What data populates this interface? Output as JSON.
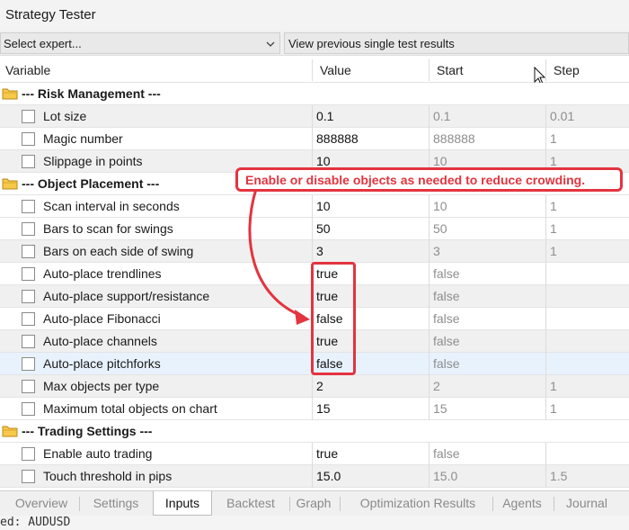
{
  "window": {
    "title": "Strategy Tester"
  },
  "toolbar": {
    "expert_select": "Select expert...",
    "view_previous": "View previous single test results"
  },
  "columns": {
    "variable": "Variable",
    "value": "Value",
    "start": "Start",
    "step": "Step"
  },
  "rows": [
    {
      "kind": "group",
      "label": "--- Risk Management ---"
    },
    {
      "kind": "param",
      "label": "Lot size",
      "value": "0.1",
      "start": "0.1",
      "step": "0.01",
      "shade": "gray"
    },
    {
      "kind": "param",
      "label": "Magic number",
      "value": "888888",
      "start": "888888",
      "step": "1",
      "shade": "white"
    },
    {
      "kind": "param",
      "label": "Slippage in points",
      "value": "10",
      "start": "10",
      "step": "1",
      "shade": "gray"
    },
    {
      "kind": "group",
      "label": "--- Object Placement ---"
    },
    {
      "kind": "param",
      "label": "Scan interval in seconds",
      "value": "10",
      "start": "10",
      "step": "1",
      "shade": "white"
    },
    {
      "kind": "param",
      "label": "Bars to scan for swings",
      "value": "50",
      "start": "50",
      "step": "1",
      "shade": "white"
    },
    {
      "kind": "param",
      "label": "Bars on each side of swing",
      "value": "3",
      "start": "3",
      "step": "1",
      "shade": "gray"
    },
    {
      "kind": "param",
      "label": "Auto-place trendlines",
      "value": "true",
      "start": "false",
      "step": "",
      "shade": "white"
    },
    {
      "kind": "param",
      "label": "Auto-place support/resistance",
      "value": "true",
      "start": "false",
      "step": "",
      "shade": "gray"
    },
    {
      "kind": "param",
      "label": "Auto-place Fibonacci",
      "value": "false",
      "start": "false",
      "step": "",
      "shade": "white"
    },
    {
      "kind": "param",
      "label": "Auto-place channels",
      "value": "true",
      "start": "false",
      "step": "",
      "shade": "gray"
    },
    {
      "kind": "param",
      "label": "Auto-place pitchforks",
      "value": "false",
      "start": "false",
      "step": "",
      "shade": "sel"
    },
    {
      "kind": "param",
      "label": "Max objects per type",
      "value": "2",
      "start": "2",
      "step": "1",
      "shade": "gray"
    },
    {
      "kind": "param",
      "label": "Maximum total objects on chart",
      "value": "15",
      "start": "15",
      "step": "1",
      "shade": "white"
    },
    {
      "kind": "group",
      "label": "--- Trading Settings ---"
    },
    {
      "kind": "param",
      "label": "Enable auto trading",
      "value": "true",
      "start": "false",
      "step": "",
      "shade": "white"
    },
    {
      "kind": "param",
      "label": "Touch threshold in pips",
      "value": "15.0",
      "start": "15.0",
      "step": "1.5",
      "shade": "gray"
    }
  ],
  "tabs": [
    {
      "label": "Overview",
      "active": false
    },
    {
      "label": "Settings",
      "active": false
    },
    {
      "label": "Inputs",
      "active": true
    },
    {
      "label": "Backtest",
      "active": false
    },
    {
      "label": "Graph",
      "active": false
    },
    {
      "label": "Optimization Results",
      "active": false
    },
    {
      "label": "Agents",
      "active": false
    },
    {
      "label": "Journal",
      "active": false
    }
  ],
  "console": {
    "text": "ed: AUDUSD"
  },
  "annotation": {
    "text": "Enable or disable objects as needed to reduce crowding.",
    "color": "#e3343f"
  },
  "icons": {
    "group": "folder-icon",
    "dropdown": "chevron-down-icon",
    "pointer": "mouse-cursor-icon"
  }
}
